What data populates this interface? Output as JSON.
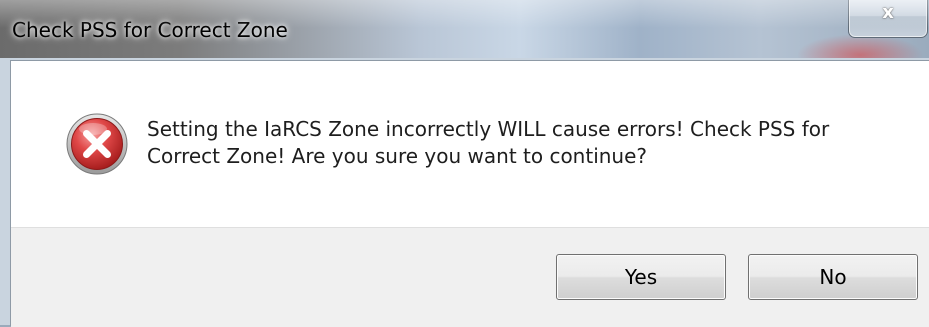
{
  "window": {
    "title": "Check PSS for Correct Zone",
    "close_glyph": "x"
  },
  "dialog": {
    "icon": "error-icon",
    "icon_color": "#d23a3a",
    "message": "Setting the IaRCS Zone incorrectly WILL cause errors!  Check PSS for Correct Zone!  Are you sure you want to continue?"
  },
  "buttons": {
    "yes_label": "Yes",
    "no_label": "No"
  }
}
